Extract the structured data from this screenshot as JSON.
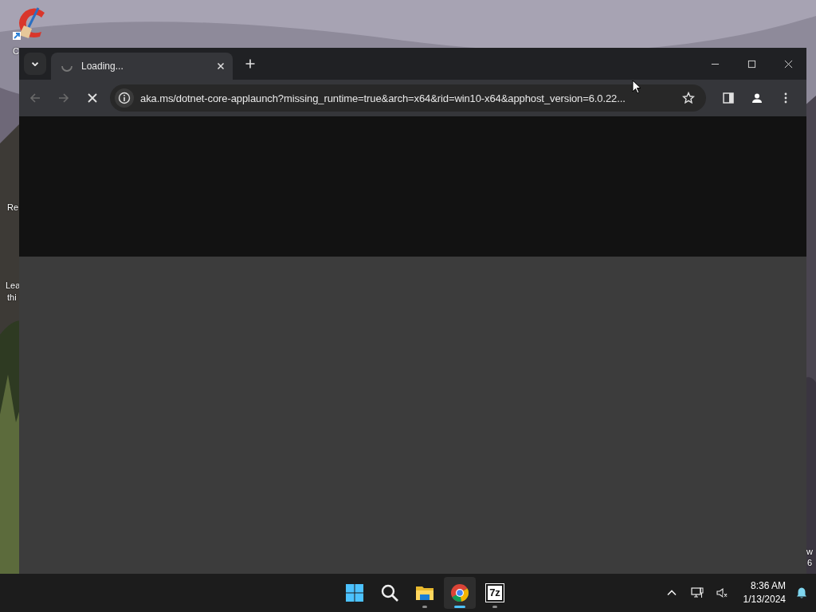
{
  "desktop": {
    "labels": [
      {
        "text": "C"
      },
      {
        "text": "Re"
      },
      {
        "text": "Lea"
      },
      {
        "text": "thi"
      },
      {
        "text": "w"
      },
      {
        "text": "6"
      }
    ]
  },
  "browser": {
    "tabs": [
      {
        "title": "Loading...",
        "loading": true,
        "selected": true
      }
    ],
    "address": "aka.ms/dotnet-core-applaunch?missing_runtime=true&arch=x64&rid=win10-x64&apphost_version=6.0.22...",
    "loading": true
  },
  "taskbar": {
    "apps": [
      {
        "kind": "start",
        "running": false,
        "selected": false
      },
      {
        "kind": "search",
        "running": false,
        "selected": false
      },
      {
        "kind": "explorer",
        "running": true,
        "selected": false
      },
      {
        "kind": "chrome",
        "running": true,
        "selected": true
      },
      {
        "kind": "sevenzip",
        "label": "7z",
        "running": true,
        "selected": false
      }
    ],
    "time": "8:36 AM",
    "date": "1/13/2024"
  }
}
